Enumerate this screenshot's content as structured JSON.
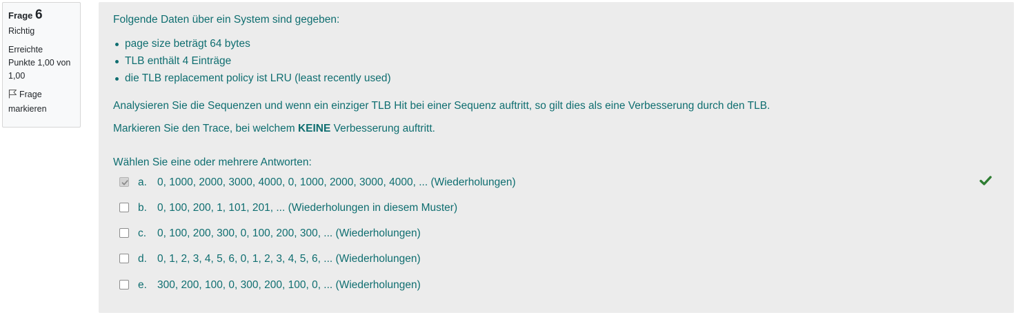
{
  "info": {
    "label": "Frage",
    "number": "6",
    "state": "Richtig",
    "grade_line1": "Erreichte",
    "grade_line2": "Punkte 1,00 von",
    "grade_line3": "1,00",
    "flag_line1": "Frage",
    "flag_line2": "markieren"
  },
  "question": {
    "intro": "Folgende Daten über ein System sind gegeben:",
    "bullets": [
      "page size beträgt 64 bytes",
      "TLB enthält 4 Einträge",
      "die TLB replacement policy ist LRU (least recently used)"
    ],
    "analyze": "Analysieren Sie die Sequenzen und wenn ein einziger TLB Hit bei einer Sequenz auftritt, so gilt dies als eine Verbesserung durch den TLB.",
    "mark_pre": "Markieren Sie den Trace, bei welchem",
    "mark_keyword": "KEINE",
    "mark_post": "Verbesserung auftritt.",
    "prompt": "Wählen Sie eine oder mehrere Antworten:"
  },
  "answers": [
    {
      "letter": "a.",
      "text": "0, 1000, 2000, 3000, 4000, 0, 1000, 2000, 3000, 4000, ... (Wiederholungen)",
      "checked": true
    },
    {
      "letter": "b.",
      "text": "0, 100, 200, 1, 101, 201, ... (Wiederholungen in diesem Muster)",
      "checked": false
    },
    {
      "letter": "c.",
      "text": "0, 100, 200, 300, 0, 100, 200, 300, ... (Wiederholungen)",
      "checked": false
    },
    {
      "letter": "d.",
      "text": "0, 1, 2, 3, 4, 5, 6, 0, 1, 2, 3, 4, 5, 6, ... (Wiederholungen)",
      "checked": false
    },
    {
      "letter": "e.",
      "text": "300, 200, 100, 0, 300, 200, 100, 0, ... (Wiederholungen)",
      "checked": false
    }
  ],
  "icons": {
    "flag": "flag-icon",
    "correct": "check-mark-icon"
  },
  "colors": {
    "text_teal": "#0f6e70",
    "correct_green": "#2e7d32",
    "content_bg": "#ececec"
  }
}
